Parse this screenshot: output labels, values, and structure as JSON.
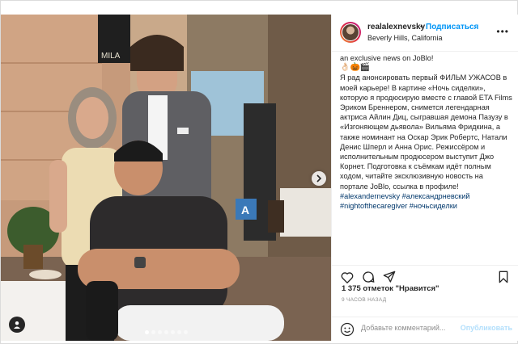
{
  "header": {
    "username": "realalexnevsky",
    "separator": "•",
    "follow_label": "Подписаться",
    "location": "Beverly Hills, California",
    "more_icon": "more-dots-icon"
  },
  "photo": {
    "sign_text": "MILA",
    "street_sign_text": "A",
    "carousel": {
      "count": 7,
      "active_index": 0
    }
  },
  "caption": {
    "lines_top": "an exclusive news on JoBlo!",
    "emojis": "👌🏻🎃🎬",
    "body": "Я рад анонсировать первый ФИЛЬМ УЖАСОВ в моей карьере! В картине «Ночь сиделки», которую я продюсирую вместе с главой ETA Films Эриком Бреннером, снимется легендарная актриса Айлин Диц, сыгравшая демона Пазузу в «Изгоняющем дьявола» Вильяма Фридкина, а также номинант на Оскар Эрик Робертс, Натали Денис Шперл и Анна Орис. Режиссёром и исполнительным продюсером выступит Джо Корнет. Подготовка к съёмкам идёт полным ходом, читайте эксклюзивную новость на портале JoBlo, ссылка в профиле!",
    "hashtags": "#alexandernevsky #александрневский #nightofthecaregiver #ночьсиделки"
  },
  "actions": {
    "like_icon": "heart-icon",
    "comment_icon": "comment-icon",
    "share_icon": "share-icon",
    "save_icon": "bookmark-icon"
  },
  "likes_text": "1 375 отметок \"Нравится\"",
  "timestamp": "9 ЧАСОВ НАЗАД",
  "comment": {
    "placeholder": "Добавьте комментарий...",
    "publish_label": "Опубликовать"
  },
  "colors": {
    "follow": "#0095f6",
    "publish_disabled": "#b2dffc",
    "hashtag": "#00376b"
  }
}
